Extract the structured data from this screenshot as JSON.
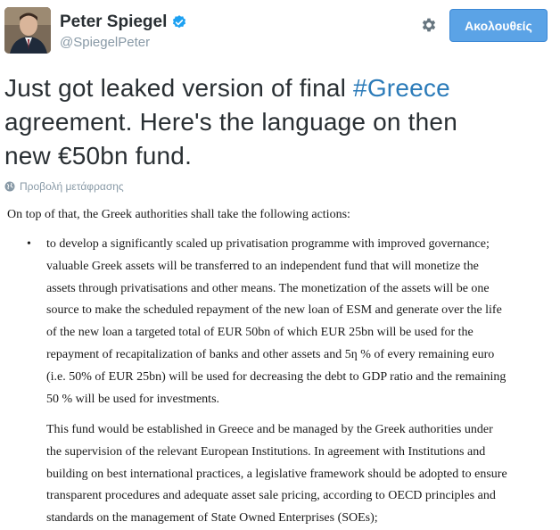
{
  "user": {
    "name": "Peter Spiegel",
    "handle": "@SpiegelPeter"
  },
  "actions": {
    "follow_label": "Ακολουθείς"
  },
  "tweet": {
    "line1_prefix": "Just got leaked version of final ",
    "hashtag": "#Greece",
    "line2": "agreement. Here's the language on then",
    "line3": "new €50bn fund."
  },
  "translate_label": "Προβολή μετάφρασης",
  "document": {
    "intro": "On top of that, the Greek authorities shall take the following actions:",
    "bullet_symbol": "•",
    "bullet_lines": [
      "to develop a significantly scaled up privatisation programme with improved governance;",
      "valuable Greek assets will be transferred to an independent fund that will monetize the",
      "assets through privatisations and other means. The monetization of the assets will be one",
      "source to make the scheduled repayment of the new loan of ESM and generate over the life",
      "of the new loan a targeted total of EUR 50bn of which EUR 25bn will be used for the",
      "repayment of recapitalization of banks and other assets and 5ƞ % of every remaining euro",
      "(i.e. 50% of EUR 25bn) will be used for decreasing the debt to GDP ratio and the remaining",
      "50 % will be used for investments."
    ],
    "para_lines": [
      "This fund would be established in Greece and be managed by the Greek authorities under",
      "the supervision of the relevant European Institutions. In agreement with Institutions and",
      "building on best international practices, a legislative framework should be adopted to ensure",
      "transparent procedures and adequate asset sale pricing, according to OECD principles and",
      "standards on the management of State Owned Enterprises (SOEs);"
    ]
  },
  "colors": {
    "follow_bg": "#5ba3e6",
    "hashtag": "#2b7bb9",
    "verified": "#1da1f2",
    "muted": "#8899a6"
  },
  "icons": [
    "verified-badge-icon",
    "gear-icon",
    "globe-icon"
  ]
}
